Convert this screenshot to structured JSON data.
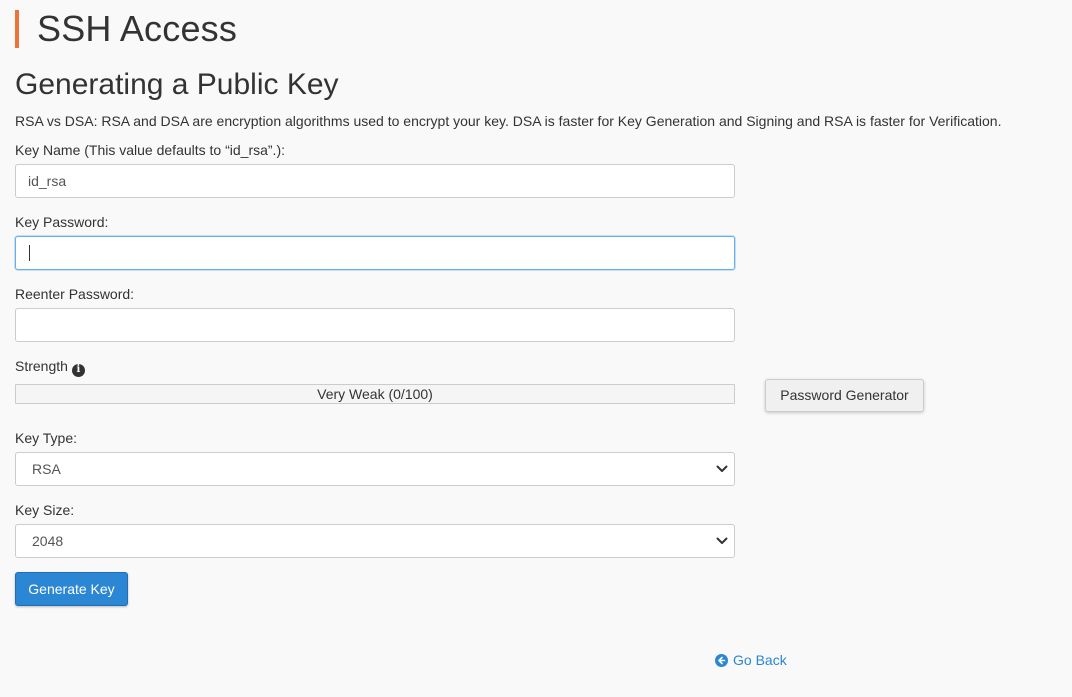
{
  "header": {
    "title": "SSH Access"
  },
  "section": {
    "title": "Generating a Public Key",
    "description": "RSA vs DSA: RSA and DSA are encryption algorithms used to encrypt your key. DSA is faster for Key Generation and Signing and RSA is faster for Verification."
  },
  "form": {
    "key_name": {
      "label": "Key Name (This value defaults to “id_rsa”.):",
      "value": "id_rsa"
    },
    "key_password": {
      "label": "Key Password:",
      "value": ""
    },
    "reenter_password": {
      "label": "Reenter Password:",
      "value": ""
    },
    "strength": {
      "label": "Strength",
      "text": "Very Weak (0/100)",
      "score": 0,
      "max": 100
    },
    "password_generator_label": "Password Generator",
    "key_type": {
      "label": "Key Type:",
      "selected": "RSA"
    },
    "key_size": {
      "label": "Key Size:",
      "selected": "2048"
    },
    "generate_label": "Generate Key"
  },
  "footer": {
    "go_back_label": "Go Back"
  },
  "colors": {
    "accent": "#ec7438",
    "primary": "#2b87d3",
    "focus": "#66afe9"
  },
  "icons": {
    "info": "info-icon",
    "back": "circle-arrow-left-icon",
    "dropdown": "chevron-down-icon"
  }
}
